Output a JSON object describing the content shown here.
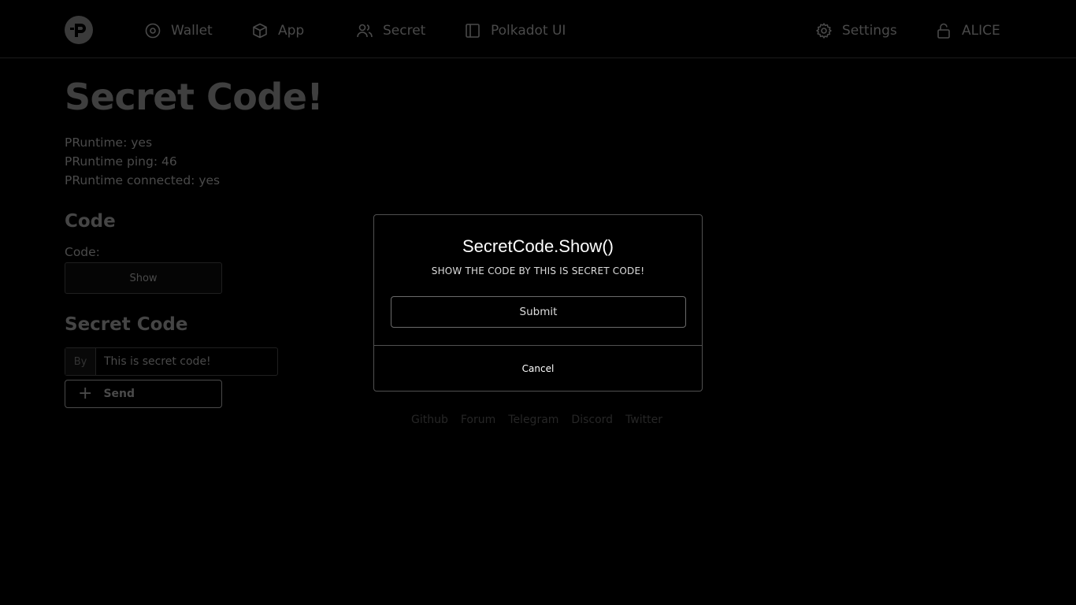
{
  "nav": {
    "wallet": "Wallet",
    "app": "App",
    "secret": "Secret",
    "polkadot": "Polkadot UI",
    "settings": "Settings",
    "account": "ALICE"
  },
  "page": {
    "title": "Secret Code!",
    "status": [
      "PRuntime: yes",
      "PRuntime ping: 46",
      "PRuntime connected: yes"
    ],
    "code_section": {
      "title": "Code",
      "label": "Code:",
      "show_button": "Show"
    },
    "secret_section": {
      "title": "Secret Code",
      "addon": "By",
      "input_value": "This is secret code!",
      "send_button": "Send"
    }
  },
  "footer": {
    "links": [
      "Github",
      "Forum",
      "Telegram",
      "Discord",
      "Twitter"
    ]
  },
  "modal": {
    "title": "SecretCode.Show()",
    "subtitle": "SHOW THE CODE BY THIS IS SECRET CODE!",
    "submit": "Submit",
    "cancel": "Cancel"
  },
  "icons": {
    "logo": "phala-logo-icon",
    "wallet": "wallet-icon",
    "app": "cube-icon",
    "secret": "users-icon",
    "polkadot": "sidebar-icon",
    "settings": "gear-icon",
    "account": "lock-open-icon"
  }
}
